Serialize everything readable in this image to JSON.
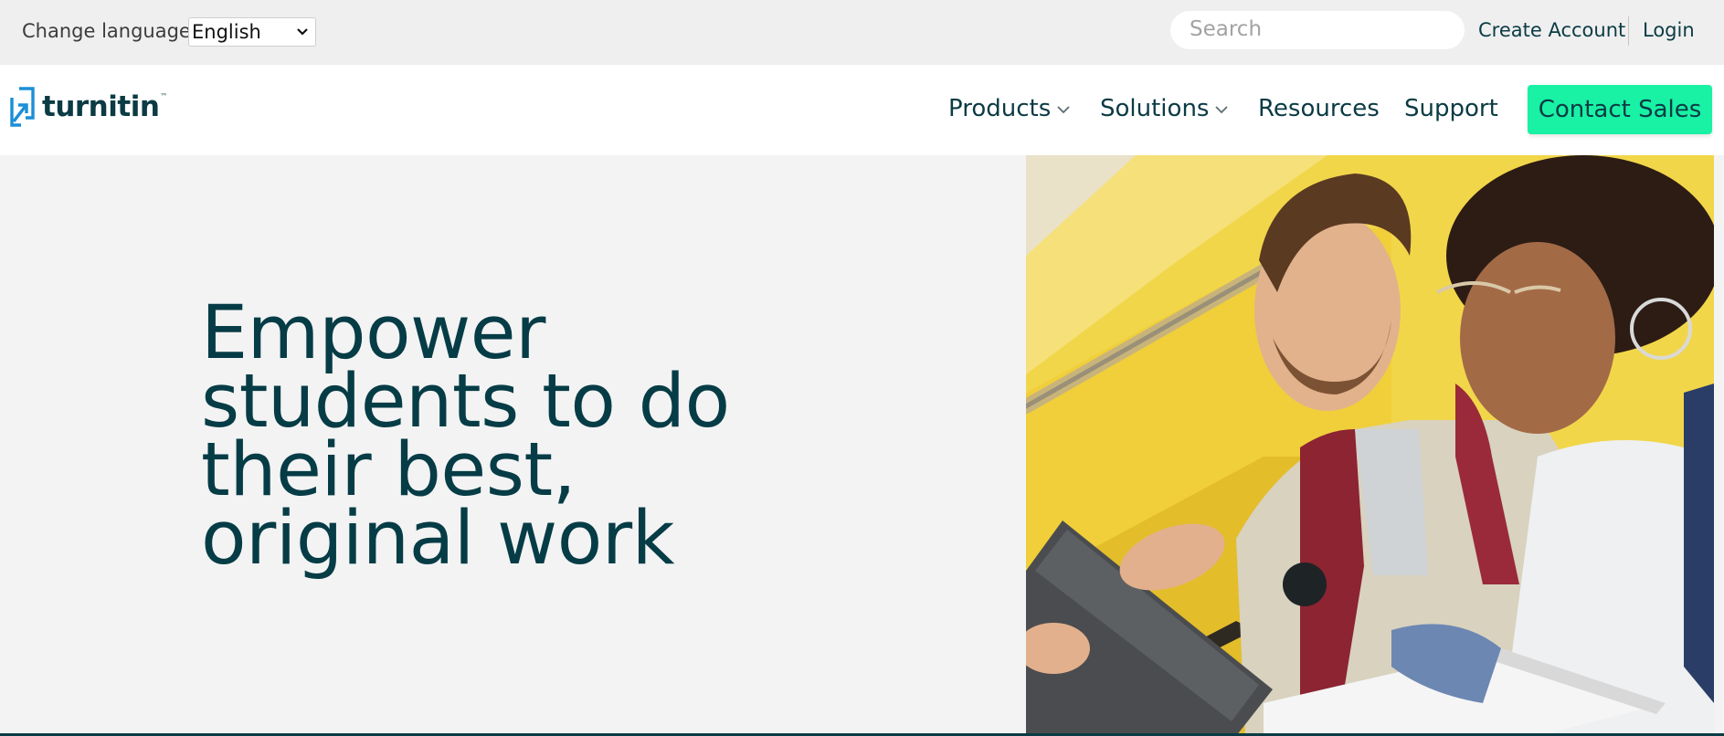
{
  "utility_bar": {
    "language_label": "Change language",
    "language_selected": "English",
    "search_placeholder": "Search",
    "create_account": "Create Account",
    "login": "Login"
  },
  "nav": {
    "logo_text": "turnitin",
    "logo_tm": "™",
    "items": [
      {
        "label": "Products",
        "has_dropdown": true
      },
      {
        "label": "Solutions",
        "has_dropdown": true
      },
      {
        "label": "Resources",
        "has_dropdown": false
      },
      {
        "label": "Support",
        "has_dropdown": false
      }
    ],
    "cta": "Contact Sales"
  },
  "hero": {
    "headline_lines": [
      "Empower",
      "students to do",
      "their best,",
      "original work"
    ],
    "image_icon": "students-photo"
  },
  "colors": {
    "brand_dark": "#0b3b44",
    "cta_green": "#19f1a5",
    "logo_blue": "#1a8fd6",
    "background": "#f3f3f3"
  }
}
